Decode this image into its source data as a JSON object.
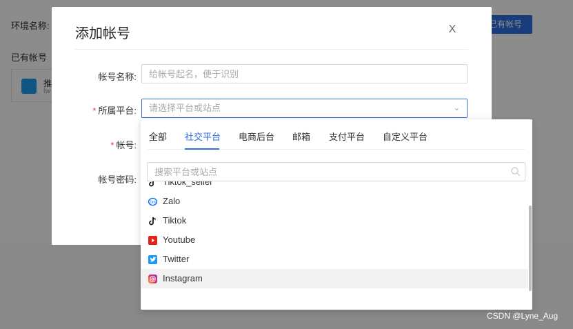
{
  "background": {
    "env_label": "环境名称:",
    "existing_label": "已有帐号",
    "top_button": "已有帐号",
    "card": {
      "title": "推",
      "subtitle": "tw"
    }
  },
  "modal": {
    "title": "添加帐号",
    "close_label": "X",
    "fields": {
      "name": {
        "label": "帐号名称:",
        "placeholder": "给帐号起名，便于识别"
      },
      "platform": {
        "label": "所属平台:",
        "placeholder": "请选择平台或站点",
        "required_mark": "*"
      },
      "account": {
        "label": "帐号:",
        "required_mark": "*"
      },
      "password": {
        "label": "帐号密码:"
      }
    }
  },
  "dropdown": {
    "tabs": [
      "全部",
      "社交平台",
      "电商后台",
      "邮箱",
      "支付平台",
      "自定义平台"
    ],
    "active_tab": "社交平台",
    "search_placeholder": "搜索平台或站点",
    "items": [
      {
        "label": "Tiktok_seller",
        "icon": "tiktok-icon",
        "color": "#111111"
      },
      {
        "label": "Zalo",
        "icon": "zalo-icon",
        "color": "#0068ff"
      },
      {
        "label": "Tiktok",
        "icon": "tiktok-icon",
        "color": "#111111"
      },
      {
        "label": "Youtube",
        "icon": "youtube-icon",
        "color": "#e62117"
      },
      {
        "label": "Twitter",
        "icon": "twitter-icon",
        "color": "#1d9bf0"
      },
      {
        "label": "Instagram",
        "icon": "instagram-icon",
        "color": "#d6249f"
      }
    ],
    "hovered_item": "Instagram"
  },
  "watermark": "CSDN @Lyne_Aug",
  "colors": {
    "accent": "#2f6de1",
    "required": "#e4393c"
  }
}
